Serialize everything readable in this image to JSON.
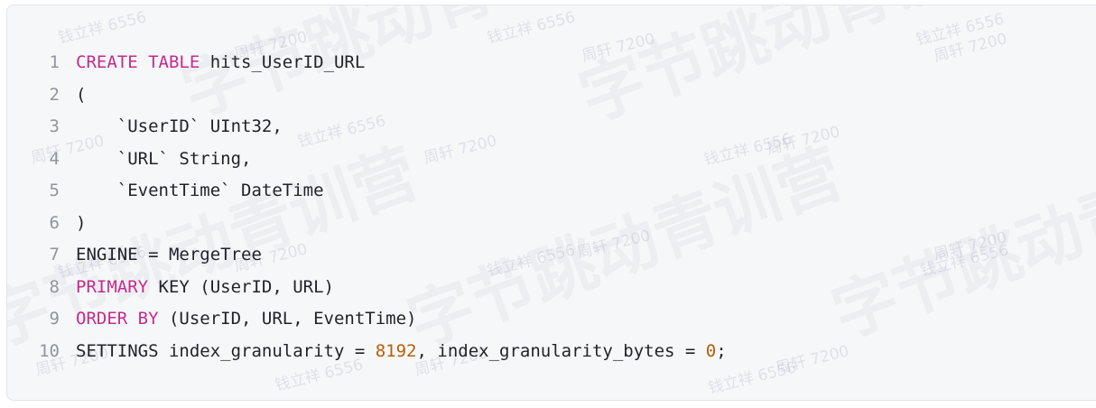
{
  "code_block": {
    "language": "sql",
    "lines": [
      {
        "num": "1",
        "segments": [
          {
            "t": "CREATE TABLE",
            "k": "kw"
          },
          {
            "t": " hits_UserID_URL"
          }
        ]
      },
      {
        "num": "2",
        "segments": [
          {
            "t": "("
          }
        ]
      },
      {
        "num": "3",
        "segments": [
          {
            "t": "    `UserID` UInt32,"
          }
        ]
      },
      {
        "num": "4",
        "segments": [
          {
            "t": "    `URL` String,"
          }
        ]
      },
      {
        "num": "5",
        "segments": [
          {
            "t": "    `EventTime` DateTime"
          }
        ]
      },
      {
        "num": "6",
        "segments": [
          {
            "t": ")"
          }
        ]
      },
      {
        "num": "7",
        "segments": [
          {
            "t": "ENGINE = MergeTree"
          }
        ]
      },
      {
        "num": "8",
        "segments": [
          {
            "t": "PRIMARY",
            "k": "kw"
          },
          {
            "t": " KEY (UserID, URL)"
          }
        ]
      },
      {
        "num": "9",
        "segments": [
          {
            "t": "ORDER BY",
            "k": "kw"
          },
          {
            "t": " (UserID, URL, EventTime)"
          }
        ]
      },
      {
        "num": "10",
        "segments": [
          {
            "t": "SETTINGS index_granularity = "
          },
          {
            "t": "8192",
            "k": "num"
          },
          {
            "t": ", index_granularity_bytes = "
          },
          {
            "t": "0",
            "k": "num"
          },
          {
            "t": ";"
          }
        ]
      }
    ]
  },
  "colors": {
    "background": "#f6f7f8",
    "keyword": "#c42c8c",
    "number": "#b5600a",
    "line_number": "#8f959e",
    "text": "#1f2329"
  },
  "watermark": {
    "large_text": "字节跳动青训营",
    "small_text_1": "钱立祥 6556",
    "small_text_2": "周轩 7200"
  }
}
